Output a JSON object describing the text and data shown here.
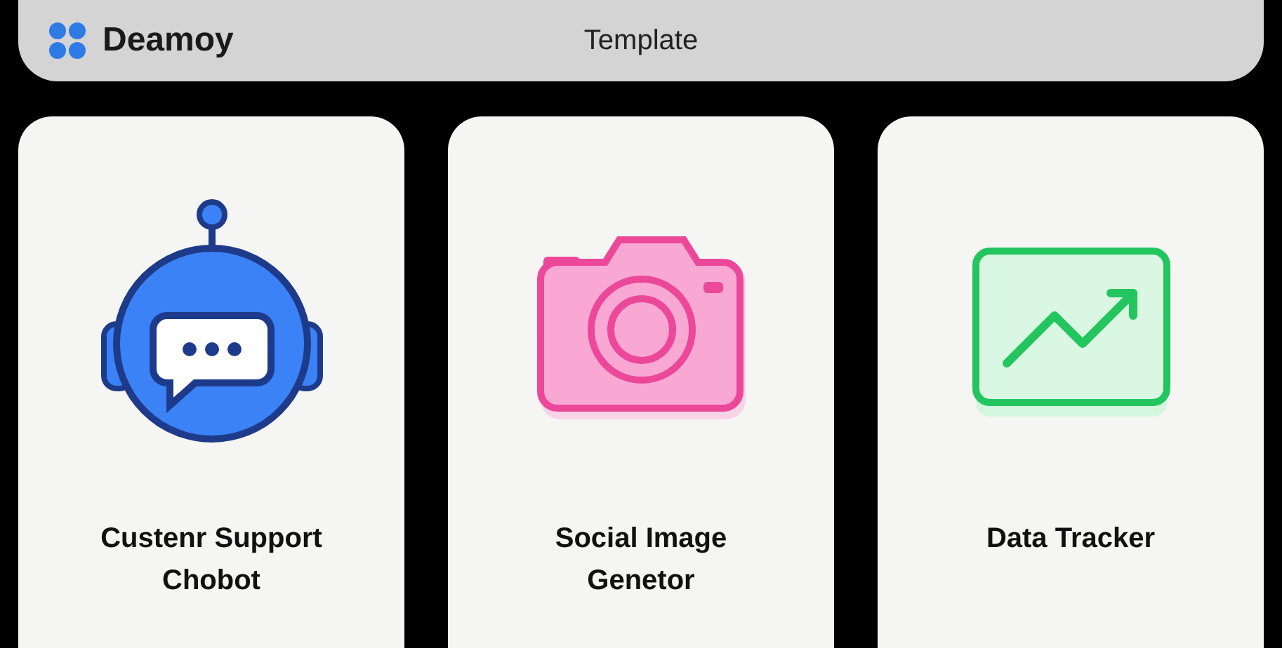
{
  "header": {
    "brand": "Deamoy",
    "title": "Template"
  },
  "cards": [
    {
      "title": "Custenr Support Chobot",
      "kind": "chatbot"
    },
    {
      "title": "Social Image Genetor",
      "kind": "camera"
    },
    {
      "title": "Data Tracker",
      "kind": "chart"
    }
  ]
}
